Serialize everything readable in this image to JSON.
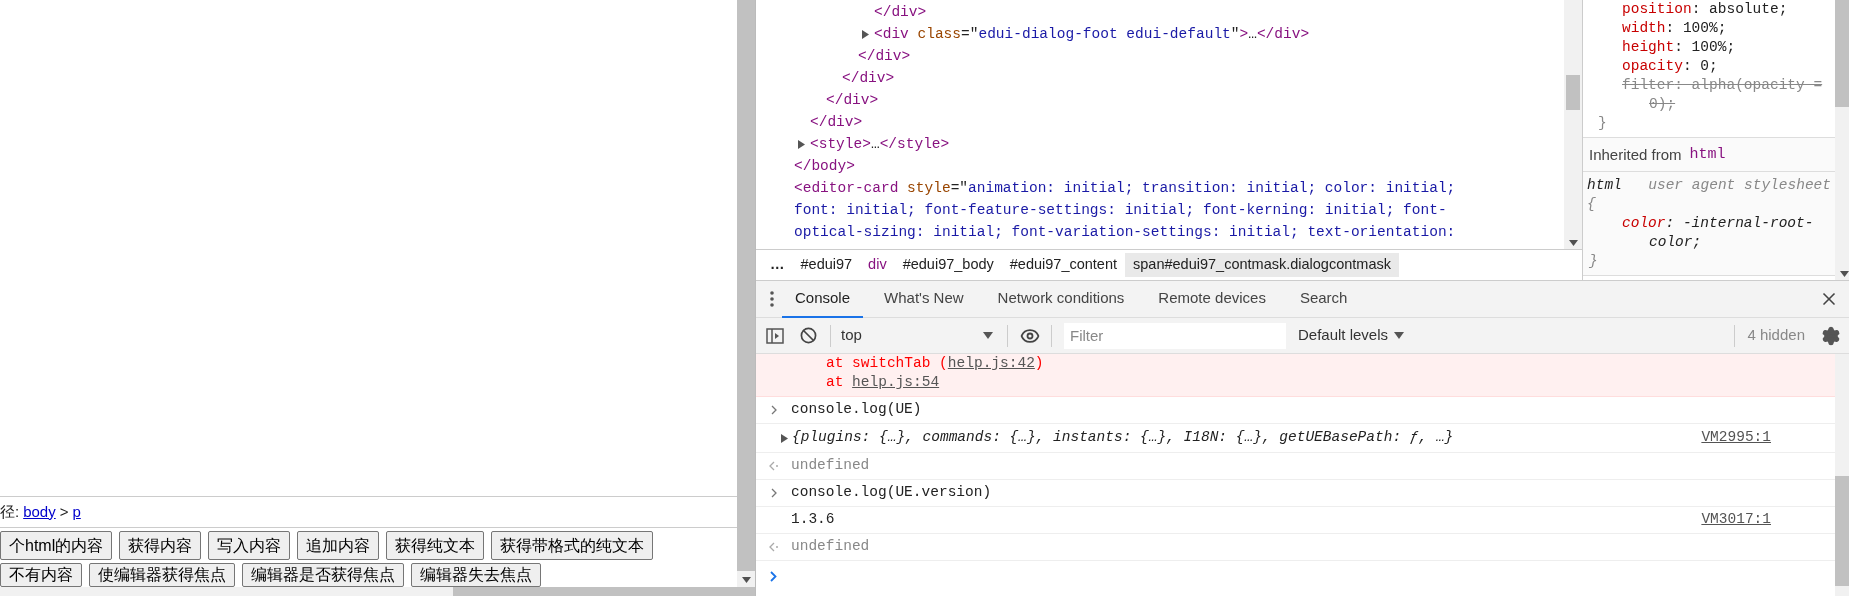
{
  "page": {
    "element_path": {
      "label": "径:",
      "crumbs": [
        "body",
        "p"
      ],
      "separator": ">"
    },
    "button_rows": [
      [
        "个html的内容",
        "获得内容",
        "写入内容",
        "追加内容",
        "获得纯文本",
        "获得带格式的纯文本"
      ],
      [
        "不有内容",
        "使编辑器获得焦点",
        "编辑器是否获得焦点",
        "编辑器失去焦点"
      ]
    ]
  },
  "elements": {
    "tree": [
      {
        "children": [
          {
            "children": [
              {
                "children": [
                  {
                    "children": [
                      {
                        "children": [
                          {
                            "close": [
                              {
                                "kind": "tag",
                                "text": "</div>"
                              }
                            ]
                          },
                          {
                            "expanded": false,
                            "open": [
                              {
                                "kind": "tag",
                                "text": "<div"
                              },
                              {
                                "kind": "attr",
                                "text": " class"
                              },
                              {
                                "kind": "plain",
                                "text": "=\""
                              },
                              {
                                "kind": "value",
                                "text": "edui-dialog-foot edui-default"
                              },
                              {
                                "kind": "plain",
                                "text": "\""
                              },
                              {
                                "kind": "tag",
                                "text": ">"
                              },
                              {
                                "kind": "plain",
                                "text": "…"
                              },
                              {
                                "kind": "tag",
                                "text": "</div>"
                              }
                            ]
                          }
                        ],
                        "close": [
                          {
                            "kind": "tag",
                            "text": "</div>"
                          }
                        ]
                      }
                    ],
                    "close": [
                      {
                        "kind": "tag",
                        "text": "</div>"
                      }
                    ]
                  }
                ],
                "close": [
                  {
                    "kind": "tag",
                    "text": "</div>"
                  }
                ]
              }
            ],
            "close": [
              {
                "kind": "tag",
                "text": "</div>"
              }
            ]
          },
          {
            "expanded": false,
            "open": [
              {
                "kind": "tag",
                "text": "<style>"
              },
              {
                "kind": "plain",
                "text": "…"
              },
              {
                "kind": "tag",
                "text": "</style>"
              }
            ]
          }
        ],
        "close": [
          {
            "kind": "tag",
            "text": "</body>"
          }
        ]
      },
      {
        "open": [
          {
            "kind": "tag",
            "text": "<editor-card"
          },
          {
            "kind": "attr",
            "text": " style"
          },
          {
            "kind": "plain",
            "text": "=\""
          },
          {
            "kind": "value",
            "text": "animation: initial; transition: initial; color: initial; font: initial; font-feature-settings: initial; font-kerning: initial; font-optical-sizing: initial; font-variation-settings: initial; text-orientation:"
          }
        ]
      }
    ]
  },
  "breadcrumbs": [
    {
      "kind": "ellipsis",
      "text": "…",
      "selected": false
    },
    {
      "kind": "node",
      "text": "#edui97",
      "selected": false
    },
    {
      "kind": "tag",
      "text": "div",
      "selected": false
    },
    {
      "kind": "node",
      "text": "#edui97_body",
      "selected": false
    },
    {
      "kind": "node",
      "text": "#edui97_content",
      "selected": false
    },
    {
      "kind": "node",
      "text": "span#edui97_contmask.dialogcontmask",
      "selected": true
    }
  ],
  "styles": {
    "rules": [
      {
        "properties": [
          {
            "name": "position",
            "value": ": absolute;",
            "overridden": false
          },
          {
            "name": "width",
            "value": ": 100%;",
            "overridden": false
          },
          {
            "name": "height",
            "value": ": 100%;",
            "overridden": false
          },
          {
            "name": "opacity",
            "value": ": 0;",
            "overridden": false
          },
          {
            "name": "filter",
            "value": ": alpha(opacity = 0);",
            "overridden": true
          }
        ],
        "close": "}"
      }
    ],
    "inherited": {
      "label": "Inherited from",
      "element": "html"
    },
    "inherited_rules": [
      {
        "selector": "html",
        "open": "{",
        "origin": "user agent stylesheet",
        "properties": [
          {
            "name": "color",
            "value": ": -internal-root-color;",
            "overridden": false
          }
        ],
        "close": "}"
      }
    ]
  },
  "drawer": {
    "tabs": [
      {
        "label": "Console",
        "selected": true
      },
      {
        "label": "What's New",
        "selected": false
      },
      {
        "label": "Network conditions",
        "selected": false
      },
      {
        "label": "Remote devices",
        "selected": false
      },
      {
        "label": "Search",
        "selected": false
      }
    ]
  },
  "console": {
    "toolbar": {
      "context": "top",
      "filter": {
        "placeholder": "Filter"
      },
      "levels": "Default levels",
      "hidden_count": "4 hidden"
    },
    "messages": [
      {
        "kind": "error",
        "lines": [
          [
            {
              "kind": "text",
              "text": "at switchTab ("
            },
            {
              "kind": "link",
              "text": "help.js:42"
            },
            {
              "kind": "text",
              "text": ")"
            }
          ],
          [
            {
              "kind": "text",
              "text": "at "
            },
            {
              "kind": "link",
              "text": "help.js:54"
            }
          ]
        ]
      },
      {
        "kind": "input",
        "text": "console.log(UE)"
      },
      {
        "kind": "object",
        "text": "{plugins: {…}, commands: {…}, instants: {…}, I18N: {…}, getUEBasePath: ƒ, …}",
        "expanded": false,
        "source": "VM2995:1"
      },
      {
        "kind": "result",
        "text": "undefined"
      },
      {
        "kind": "input",
        "text": "console.log(UE.version)"
      },
      {
        "kind": "log",
        "text": "1.3.6",
        "source": "VM3017:1"
      },
      {
        "kind": "result",
        "text": "undefined"
      },
      {
        "kind": "prompt"
      }
    ]
  }
}
